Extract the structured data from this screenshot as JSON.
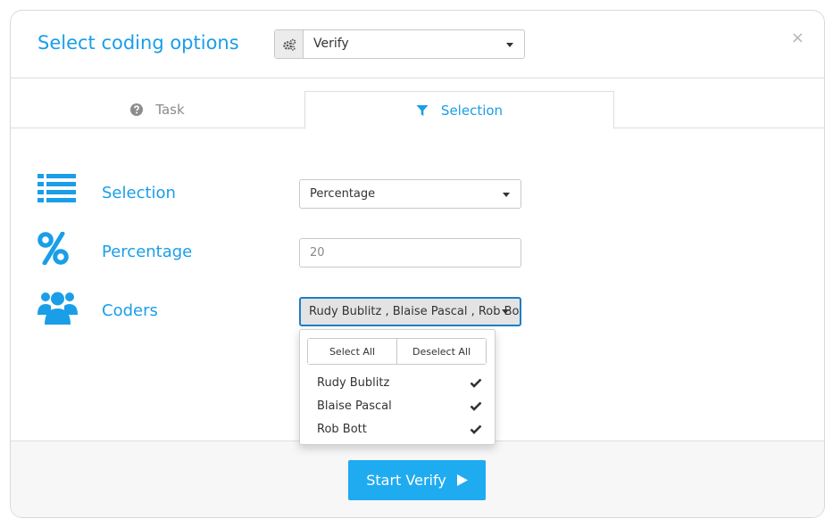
{
  "modal": {
    "title": "Select coding options",
    "close_symbol": "×",
    "mode_select": {
      "icon": "gears-icon",
      "value": "Verify"
    }
  },
  "tabs": [
    {
      "label": "Task",
      "icon": "question-circle-icon",
      "active": false
    },
    {
      "label": "Selection",
      "icon": "filter-icon",
      "active": true
    }
  ],
  "rows": {
    "selection": {
      "label": "Selection",
      "icon": "list-icon",
      "value": "Percentage"
    },
    "percentage": {
      "label": "Percentage",
      "icon": "percent-icon",
      "placeholder": "20"
    },
    "coders": {
      "label": "Coders",
      "icon": "users-icon",
      "value": "Rudy Bublitz , Blaise Pascal , Rob Bott"
    }
  },
  "coders_dropdown": {
    "select_all": "Select All",
    "deselect_all": "Deselect All",
    "options": [
      {
        "label": "Rudy Bublitz",
        "checked": true
      },
      {
        "label": "Blaise Pascal",
        "checked": true
      },
      {
        "label": "Rob Bott",
        "checked": true
      }
    ]
  },
  "footer": {
    "start_label": "Start Verify",
    "icon": "play-icon"
  },
  "colors": {
    "accent": "#1a9ee8",
    "button": "#1fabf0",
    "tab_inactive": "#8c8c8c"
  }
}
